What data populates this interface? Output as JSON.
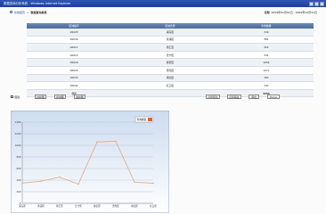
{
  "window": {
    "title": "数据查询分析系统 - Windows Internet Explorer"
  },
  "breadcrumb": {
    "home_link": "系统首页",
    "current": "数据查询报表"
  },
  "date_range": {
    "label": "日期",
    "value": "2009年01月01日 - 2009年12月31日"
  },
  "table": {
    "headers": [
      "区域编号",
      "区域名称",
      "查询数量"
    ],
    "rows": [
      [
        "00020",
        "浦东区",
        "349"
      ],
      [
        "00030",
        "黄浦区",
        "381"
      ],
      [
        "00011",
        "徐汇区",
        "452"
      ],
      [
        "00013",
        "长宁区",
        "331"
      ],
      [
        "00016",
        "静安区",
        "1059"
      ],
      [
        "00025",
        "普陀区",
        "1071"
      ],
      [
        "00033",
        "闸北区",
        "363"
      ],
      [
        "00041",
        "虹口区",
        "347"
      ]
    ],
    "total": [
      "合计",
      "",
      "4353"
    ]
  },
  "toolbar": {
    "show_chart_label": "图表",
    "left_buttons": [
      "柱状图",
      "折线图",
      "饼状图"
    ],
    "right_buttons": [
      "打印预览",
      "打印报表",
      "导出",
      "Excel"
    ]
  },
  "colors": {
    "titlebar": "#2d56b8",
    "header": "#4a6a9e",
    "chart_line": "#e3a77d",
    "chart_bg_top": "#cddcf0",
    "legend_swatch": "#e06030"
  },
  "chart_data": {
    "type": "line",
    "categories": [
      "浦东区",
      "黄浦区",
      "徐汇区",
      "长宁区",
      "静安区",
      "普陀区",
      "闸北区",
      "虹口区"
    ],
    "series": [
      {
        "name": "查询数量",
        "values": [
          349,
          381,
          452,
          331,
          1059,
          1071,
          363,
          347
        ]
      }
    ],
    "yticks": [
      0,
      200,
      400,
      600,
      800,
      1000,
      1200,
      1400
    ],
    "ylim": [
      0,
      1400
    ],
    "grid": true,
    "legend": "top-right",
    "title": "",
    "xlabel": "",
    "ylabel": ""
  }
}
